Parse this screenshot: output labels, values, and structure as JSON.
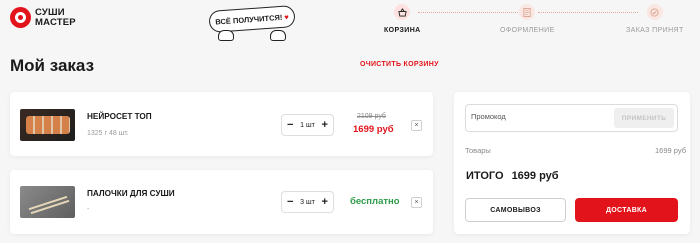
{
  "brand": {
    "line1": "СУШИ",
    "line2": "МАСТЕР",
    "accent": "#e3131b"
  },
  "mascot": {
    "text": "ВСЁ ПОЛУЧИТСЯ!",
    "heart": "♥"
  },
  "steps": [
    {
      "label": "КОРЗИНА",
      "icon": "basket-icon",
      "state": "active"
    },
    {
      "label": "ОФОРМЛЕНИЕ",
      "icon": "form-icon",
      "state": "inactive"
    },
    {
      "label": "ЗАКАЗ ПРИНЯТ",
      "icon": "check-icon",
      "state": "inactive"
    }
  ],
  "page_title": "Мой заказ",
  "clear_cart": "ОЧИСТИТЬ КОРЗИНУ",
  "items": [
    {
      "name": "НЕЙРОСЕТ ТОП",
      "desc": "1325 г 48 шт.",
      "qty": "1 шт",
      "old_price": "2109 руб",
      "price": "1699 руб",
      "remove": "×"
    },
    {
      "name": "ПАЛОЧКИ ДЛЯ СУШИ",
      "desc": "-",
      "qty": "3 шт",
      "price": "бесплатно",
      "remove": "×"
    }
  ],
  "summary": {
    "promo_placeholder": "Промокод",
    "apply": "ПРИМЕНИТЬ",
    "goods_label": "Товары",
    "goods_value": "1699 руб",
    "total_label": "ИТОГО",
    "total_value": "1699 руб",
    "pickup": "САМОВЫВОЗ",
    "delivery": "ДОСТАВКА"
  },
  "qty_minus": "−",
  "qty_plus": "+"
}
